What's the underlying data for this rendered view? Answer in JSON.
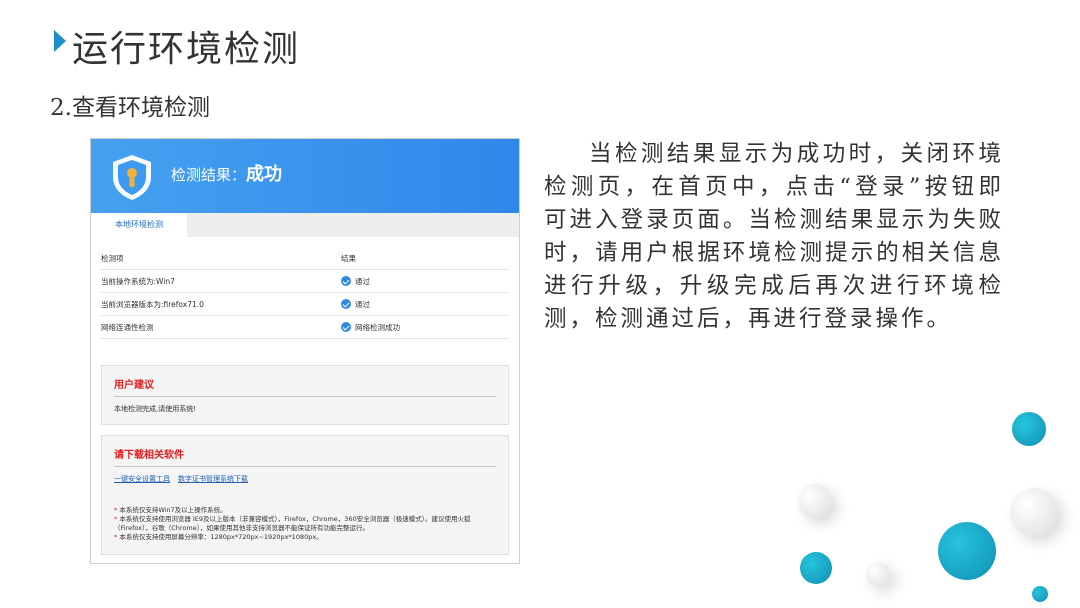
{
  "page": {
    "title": "运行环境检测",
    "subtitle": "2.查看环境检测",
    "description": "当检测结果显示为成功时，关闭环境检测页，在首页中，点击“登录”按钮即可进入登录页面。当检测结果显示为失败时，请用户根据环境检测提示的相关信息进行升级，升级完成后再次进行环境检测，检测通过后，再进行登录操作。"
  },
  "screenshot": {
    "result_label": "检测结果：",
    "result_value": "成功",
    "tab": "本地环境检测",
    "table": {
      "headers": [
        "检测项",
        "结果"
      ],
      "rows": [
        {
          "item": "当前操作系统为:Win7",
          "result": "通过"
        },
        {
          "item": "当前浏览器版本为:firefox71.0",
          "result": "通过"
        },
        {
          "item": "网络连通性检测",
          "result": "网络检测成功"
        }
      ]
    },
    "advice": {
      "title": "用户建议",
      "text": "本地检测完成,请使用系统!"
    },
    "downloads": {
      "title": "请下载相关软件",
      "link1": "一键安全设置工具",
      "link2": "数字证书管理系统下载",
      "notes": [
        "本系统仅支持Win7及以上操作系统。",
        "本系统仅支持使用浏览器 IE9及以上版本（非兼容模式），Firefox，Chrome，360安全浏览器（极速模式）。建议使用火狐（Firefox），谷歌（Chrome），如果使用其他非支持浏览器不能保证所有功能完整运行。",
        "本系统仅支持使用屏幕分辨率：1280px*720px~1920px*1080px。"
      ]
    }
  },
  "colors": {
    "accent": "#1f8fc7",
    "header_blue": "#3a96ee",
    "warning_red": "#e02020",
    "teal_bubble": "#1aa9c9"
  },
  "icons": {
    "title_marker": "triangle-right-icon",
    "shield": "shield-keyhole-icon",
    "check": "check-circle-icon"
  }
}
